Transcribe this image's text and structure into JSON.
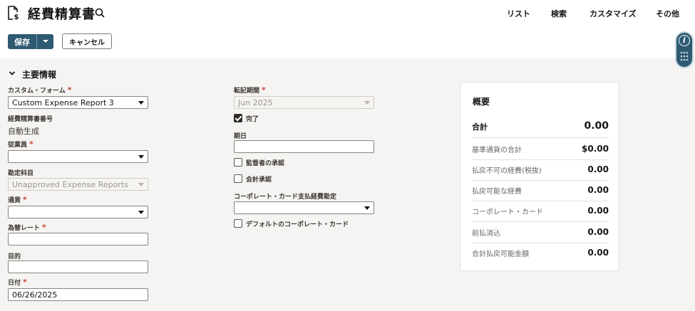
{
  "header": {
    "title": "経費精算書",
    "nav": [
      "リスト",
      "検索",
      "カスタマイズ",
      "その他"
    ]
  },
  "toolbar": {
    "save_label": "保存",
    "cancel_label": "キャンセル"
  },
  "section": {
    "title": "主要情報"
  },
  "fields": {
    "custom_form": {
      "label": "カスタム・フォーム",
      "value": "Custom Expense Report 3"
    },
    "report_number": {
      "label": "経費精算書番号",
      "value": "自動生成"
    },
    "employee": {
      "label": "従業員",
      "value": ""
    },
    "account": {
      "label": "勘定科目",
      "value": "Unapproved Expense Reports"
    },
    "currency": {
      "label": "通貨",
      "value": ""
    },
    "exchange_rate": {
      "label": "為替レート",
      "value": ""
    },
    "purpose": {
      "label": "目的",
      "value": ""
    },
    "date": {
      "label": "日付",
      "value": "06/26/2025"
    },
    "posting_period": {
      "label": "転記期間",
      "value": "Jun 2025"
    },
    "complete": {
      "label": "完了",
      "checked": true
    },
    "due_date": {
      "label": "期日",
      "value": ""
    },
    "supervisor_approval": {
      "label": "監督者の承認",
      "checked": false
    },
    "accounting_approval": {
      "label": "会計承認",
      "checked": false
    },
    "corp_card_account": {
      "label": "コーポレート・カード支払経費勘定",
      "value": ""
    },
    "default_corp_card": {
      "label": "デフォルトのコーポレート・カード",
      "checked": false
    }
  },
  "summary": {
    "title": "概要",
    "total_label": "合計",
    "total_value": "0.00",
    "rows": [
      {
        "label": "基準通貨の合計",
        "value": "$0.00"
      },
      {
        "label": "払戻不可の経費(税抜)",
        "value": "0.00"
      },
      {
        "label": "払戻可能な経費",
        "value": "0.00"
      },
      {
        "label": "コーポレート・カード",
        "value": "0.00"
      },
      {
        "label": "前払消込",
        "value": "0.00"
      },
      {
        "label": "合計払戻可能金額",
        "value": "0.00"
      }
    ]
  },
  "colors": {
    "primary": "#2e5a72",
    "required": "#c74634",
    "background": "#f5f4f2"
  }
}
